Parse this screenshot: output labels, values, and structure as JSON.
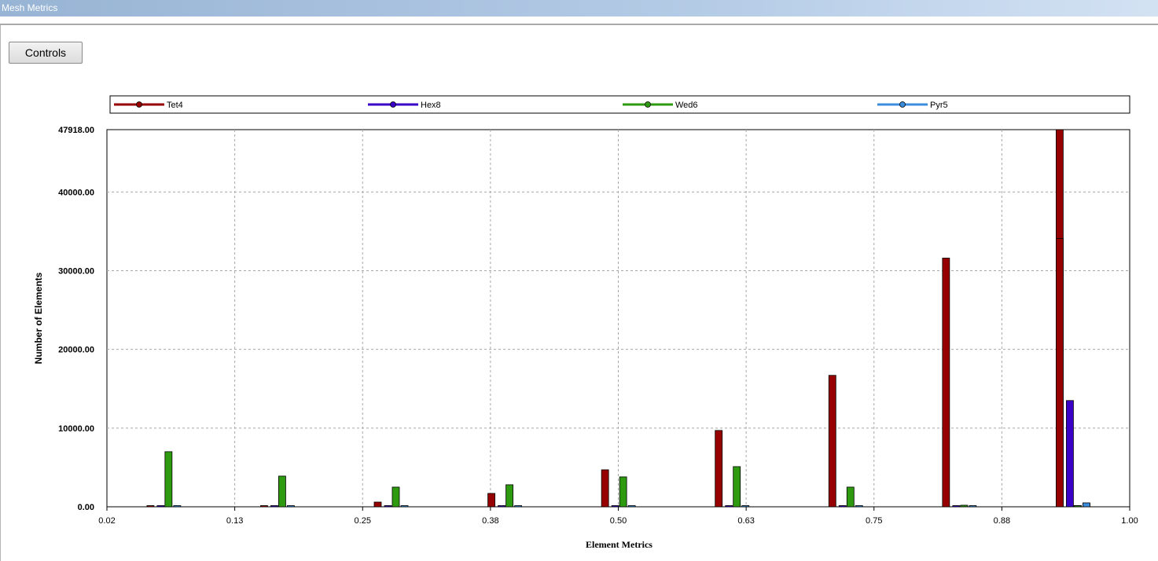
{
  "window": {
    "title": "Mesh Metrics"
  },
  "toolbar": {
    "controls_label": "Controls"
  },
  "chart_data": {
    "type": "bar",
    "xlabel": "Element Metrics",
    "ylabel": "Number of Elements",
    "xlim": [
      0.02,
      1.0
    ],
    "ylim": [
      0,
      47918
    ],
    "x_ticks": [
      "0.02",
      "0.13",
      "0.25",
      "0.38",
      "0.50",
      "0.63",
      "0.75",
      "0.88",
      "1.00"
    ],
    "y_ticks": [
      "0.00",
      "10000.00",
      "20000.00",
      "30000.00",
      "40000.00",
      "47918.00"
    ],
    "y_tick_values": [
      0,
      10000,
      20000,
      30000,
      40000,
      47918
    ],
    "grid": true,
    "legend_position": "top",
    "bin_centers": [
      0.0745,
      0.1834,
      0.2923,
      0.4012,
      0.5101,
      0.619,
      0.7279,
      0.8368,
      0.9457
    ],
    "series": [
      {
        "name": "Tet4",
        "color": "#960000",
        "values": [
          0,
          0,
          600,
          1700,
          4700,
          9700,
          16700,
          31600,
          47918,
          34100
        ]
      },
      {
        "name": "Hex8",
        "color": "#3a00c8",
        "values": [
          0,
          0,
          0,
          0,
          0,
          0,
          0,
          0,
          0,
          13500
        ]
      },
      {
        "name": "Wed6",
        "color": "#2e9a10",
        "values": [
          7000,
          3900,
          2500,
          2800,
          3800,
          5100,
          2500,
          200,
          0,
          0
        ]
      },
      {
        "name": "Pyr5",
        "color": "#3c8cdc",
        "values": [
          0,
          0,
          0,
          0,
          0,
          0,
          0,
          0,
          400,
          500
        ]
      }
    ]
  }
}
